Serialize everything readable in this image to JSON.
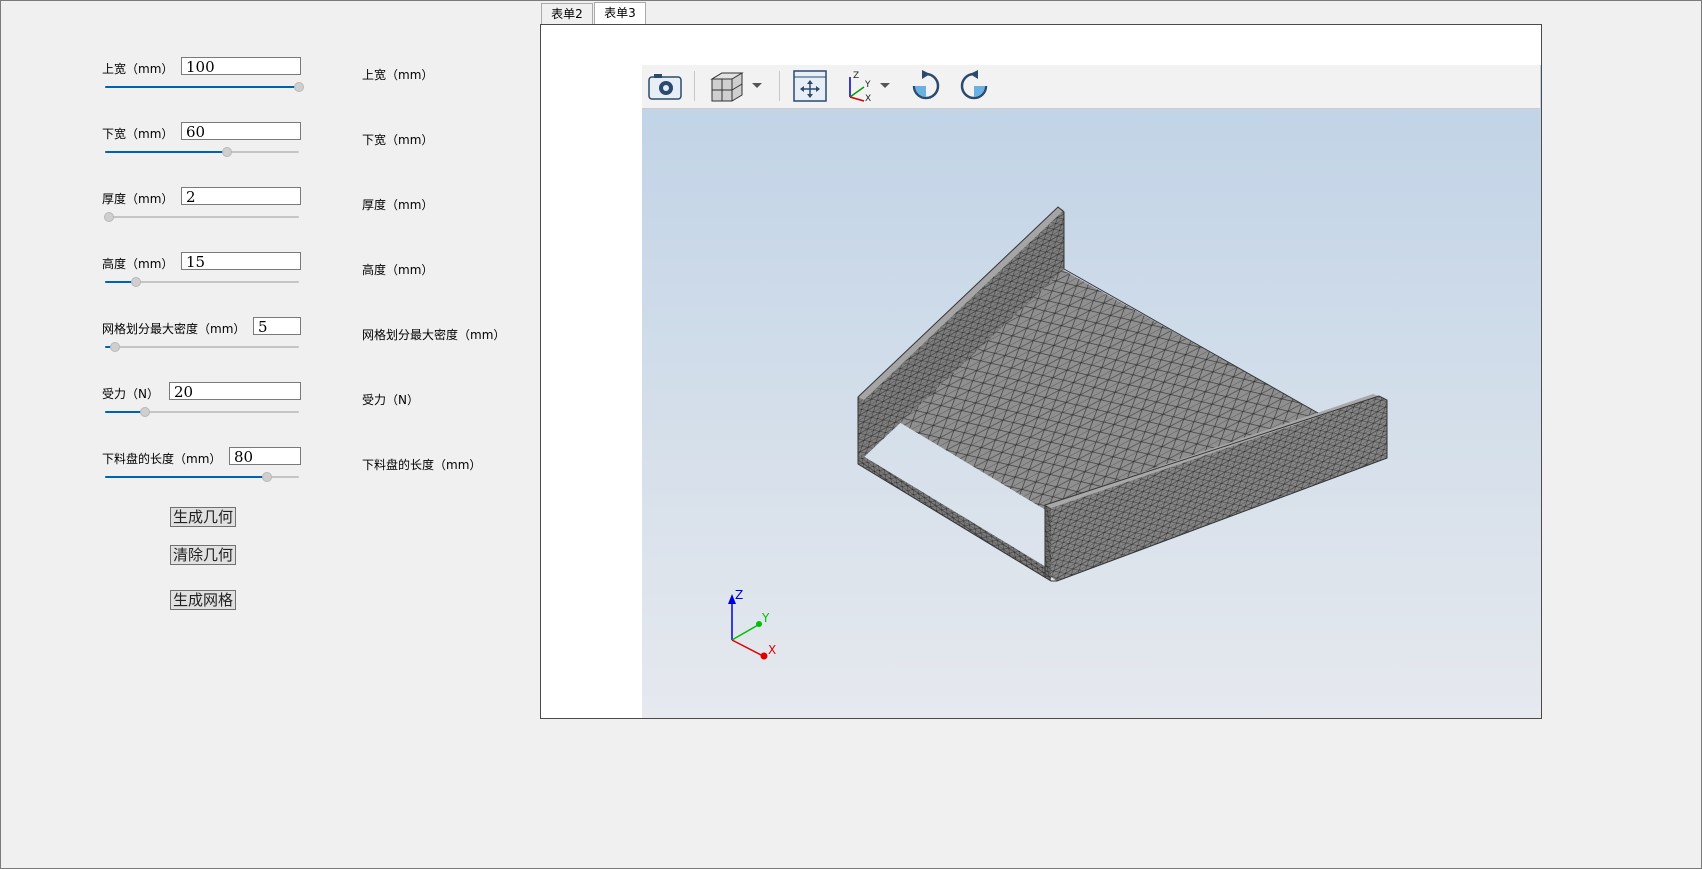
{
  "params": [
    {
      "label": "上宽（mm）",
      "value": "100",
      "slider": 1.0,
      "right_label": "上宽（mm）"
    },
    {
      "label": "下宽（mm）",
      "value": "60",
      "slider": 0.62,
      "right_label": "下宽（mm）"
    },
    {
      "label": "厚度（mm）",
      "value": "2",
      "slider": 0.0,
      "right_label": "厚度（mm）"
    },
    {
      "label": "高度（mm）",
      "value": "15",
      "slider": 0.14,
      "right_label": "高度（mm）"
    },
    {
      "label": "网格划分最大密度（mm）",
      "value": "5",
      "slider": 0.03,
      "right_label": "网格划分最大密度（mm）"
    },
    {
      "label": "受力（N）",
      "value": "20",
      "slider": 0.19,
      "right_label": "受力（N）"
    },
    {
      "label": "下料盘的长度（mm）",
      "value": "80",
      "slider": 0.83,
      "right_label": "下料盘的长度（mm）"
    }
  ],
  "buttons": {
    "generate_geometry": "生成几何",
    "clear_geometry": "清除几何",
    "generate_mesh": "生成网格"
  },
  "tabs": [
    {
      "label": "表单2",
      "active": false
    },
    {
      "label": "表单3",
      "active": true
    }
  ],
  "toolbar": {
    "icons": [
      "camera-icon",
      "view-cube-icon",
      "dropdown-arrow-icon",
      "fit-all-icon",
      "axes-orientation-icon",
      "dropdown-arrow-icon",
      "rotate-clockwise-icon",
      "rotate-counterclockwise-icon"
    ]
  },
  "axes_triad": {
    "x": "X",
    "y": "Y",
    "z": "Z"
  },
  "colors": {
    "slider_accent": "#0063b1",
    "viewer_top": "#bfd2e6",
    "viewer_bottom": "#e6e9ee",
    "mesh_fill": "#8c8c8c",
    "axis_x": "#e00000",
    "axis_y": "#00c000",
    "axis_z": "#0000e0"
  }
}
